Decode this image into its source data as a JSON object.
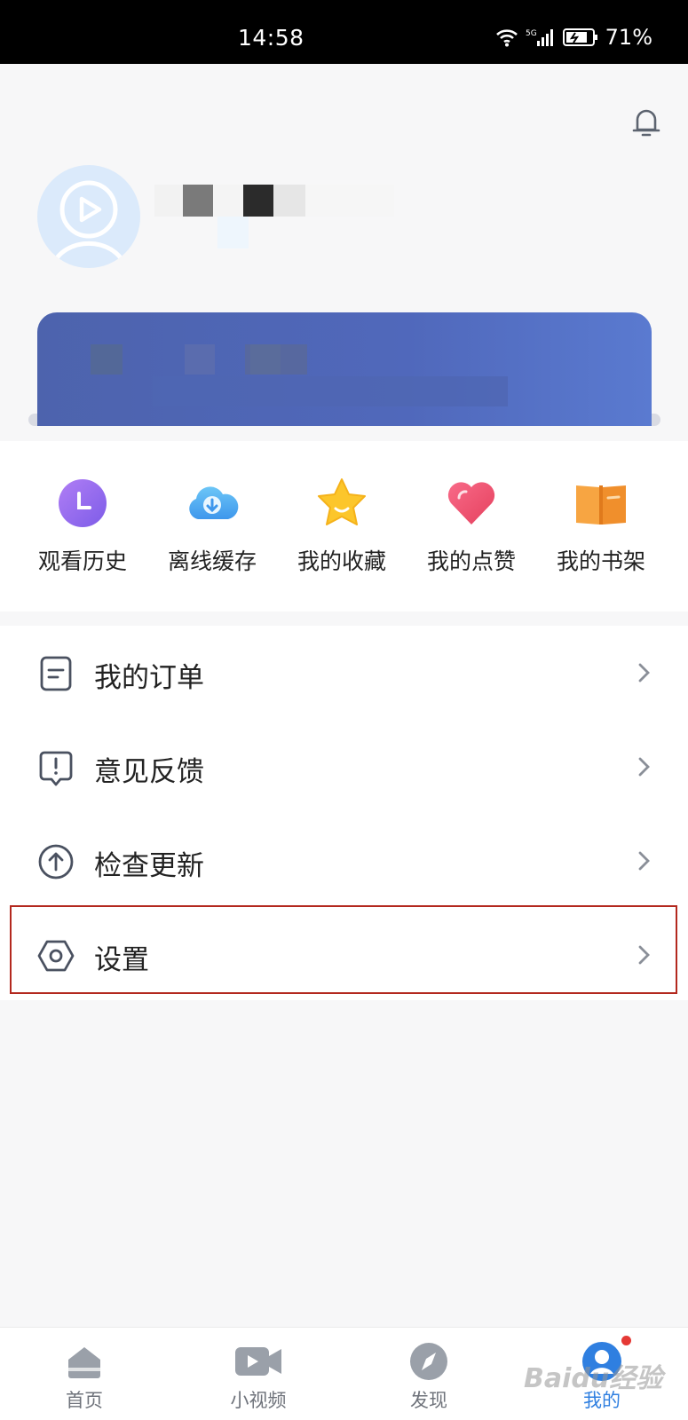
{
  "status_bar": {
    "time": "14:58",
    "battery": "71%"
  },
  "quick_tools": [
    {
      "label": "观看历史",
      "icon": "clock-icon",
      "color": "#9b6cf2"
    },
    {
      "label": "离线缓存",
      "icon": "cloud-download-icon",
      "color": "#4ba8f0"
    },
    {
      "label": "我的收藏",
      "icon": "star-icon",
      "color": "#fbc02d"
    },
    {
      "label": "我的点赞",
      "icon": "heart-icon",
      "color": "#ef5370"
    },
    {
      "label": "我的书架",
      "icon": "book-icon",
      "color": "#f59a3c"
    }
  ],
  "menu": [
    {
      "label": "我的订单",
      "icon": "order-icon"
    },
    {
      "label": "意见反馈",
      "icon": "feedback-icon"
    },
    {
      "label": "检查更新",
      "icon": "update-icon"
    },
    {
      "label": "设置",
      "icon": "settings-icon"
    }
  ],
  "bottom_nav": [
    {
      "label": "首页",
      "icon": "home-icon"
    },
    {
      "label": "小视频",
      "icon": "video-icon"
    },
    {
      "label": "发现",
      "icon": "compass-icon"
    },
    {
      "label": "我的",
      "icon": "profile-icon",
      "active": true
    }
  ],
  "watermark": "Baidu经验",
  "colors": {
    "accent": "#2f7fe0",
    "highlight_border": "#b3281e",
    "banner": "#4f66b6"
  }
}
